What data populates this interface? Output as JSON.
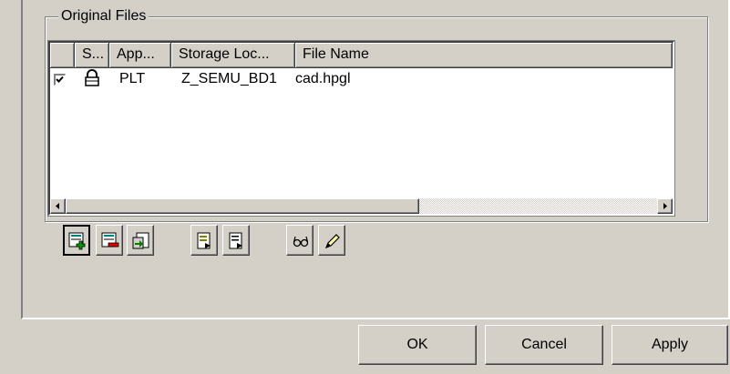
{
  "group_title": "Original Files",
  "columns": [
    "",
    "S...",
    "App...",
    "Storage Loc...",
    "File Name"
  ],
  "rows": [
    {
      "checked": true,
      "status_icon": "lock-icon",
      "app": "PLT",
      "storage": "Z_SEMU_BD1",
      "file": "cad.hpgl"
    }
  ],
  "toolbar": {
    "icons": [
      "add-file-icon",
      "remove-file-icon",
      "copy-file-icon",
      "open-document-icon",
      "edit-document-icon",
      "view-glasses-icon",
      "edit-pencil-icon"
    ]
  },
  "buttons": {
    "ok": "OK",
    "cancel": "Cancel",
    "apply": "Apply"
  },
  "colors": {
    "face": "#d4d0c8",
    "shadow": "#808080",
    "highlight": "#ffffff",
    "dark": "#404040"
  }
}
